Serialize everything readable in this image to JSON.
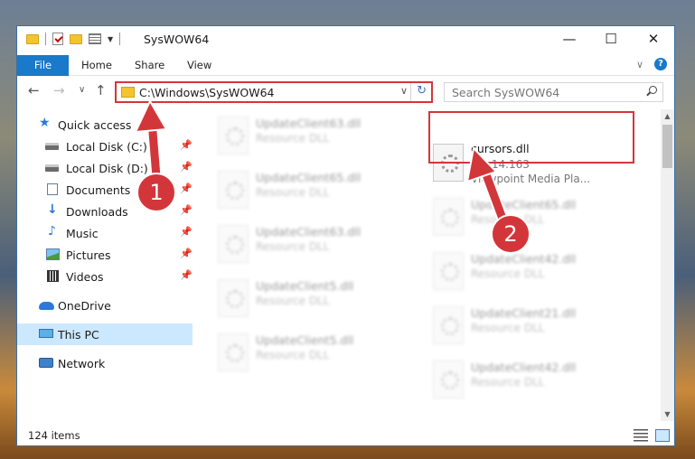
{
  "window": {
    "title": "SysWOW64",
    "minimize_icon": "minimize-icon",
    "maximize_icon": "maximize-icon",
    "close_icon": "close-icon",
    "minimize_glyph": "—",
    "maximize_glyph": "☐",
    "close_glyph": "✕"
  },
  "ribbon": {
    "tabs": [
      "File",
      "Home",
      "Share",
      "View"
    ],
    "collapse_glyph": "∨",
    "help_glyph": "?"
  },
  "nav": {
    "back_glyph": "←",
    "forward_glyph": "→",
    "recent_glyph": "∨",
    "up_glyph": "↑",
    "address": "C:\\Windows\\SysWOW64",
    "address_dropdown_glyph": "∨",
    "refresh_glyph": "↻",
    "search_placeholder": "Search SysWOW64"
  },
  "sidebar": {
    "items": [
      {
        "label": "Quick access",
        "icon": "star-icon",
        "pinned": false
      },
      {
        "label": "Local Disk (C:)",
        "icon": "drive-icon",
        "pinned": true
      },
      {
        "label": "Local Disk (D:)",
        "icon": "drive-icon",
        "pinned": true
      },
      {
        "label": "Documents",
        "icon": "documents-icon",
        "pinned": true
      },
      {
        "label": "Downloads",
        "icon": "downloads-icon",
        "pinned": true
      },
      {
        "label": "Music",
        "icon": "music-icon",
        "pinned": true
      },
      {
        "label": "Pictures",
        "icon": "pictures-icon",
        "pinned": true
      },
      {
        "label": "Videos",
        "icon": "videos-icon",
        "pinned": true
      },
      {
        "label": "OneDrive",
        "icon": "onedrive-icon",
        "pinned": false
      },
      {
        "label": "This PC",
        "icon": "this-pc-icon",
        "pinned": false,
        "selected": true
      },
      {
        "label": "Network",
        "icon": "network-icon",
        "pinned": false
      }
    ],
    "pin_glyph": "📌",
    "star_glyph": "★",
    "download_glyph": "↓",
    "music_glyph": "♪"
  },
  "files": {
    "left_column": [
      {
        "name": "UpdateClient63.dll",
        "type": "Resource DLL"
      },
      {
        "name": "UpdateClient65.dll",
        "type": "Resource DLL"
      },
      {
        "name": "UpdateClient63.dll",
        "type": "Resource DLL"
      },
      {
        "name": "UpdateClient5.dll",
        "type": "Resource DLL"
      },
      {
        "name": "UpdateClient5.dll",
        "type": "Resource DLL"
      }
    ],
    "right_column": [
      {
        "name": "UpdateClient65.dll",
        "type": "Resource DLL"
      },
      {
        "name": "UpdateClient42.dll",
        "type": "Resource DLL"
      },
      {
        "name": "UpdateClient21.dll",
        "type": "Resource DLL"
      },
      {
        "name": "UpdateClient42.dll",
        "type": "Resource DLL"
      }
    ],
    "highlighted": {
      "name": "cursors.dll",
      "version": "3.0.14.163",
      "description": "Viewpoint Media Pla..."
    }
  },
  "status": {
    "item_count": "124 items"
  },
  "annotations": {
    "step1": "1",
    "step2": "2",
    "color": "#d3363a"
  }
}
